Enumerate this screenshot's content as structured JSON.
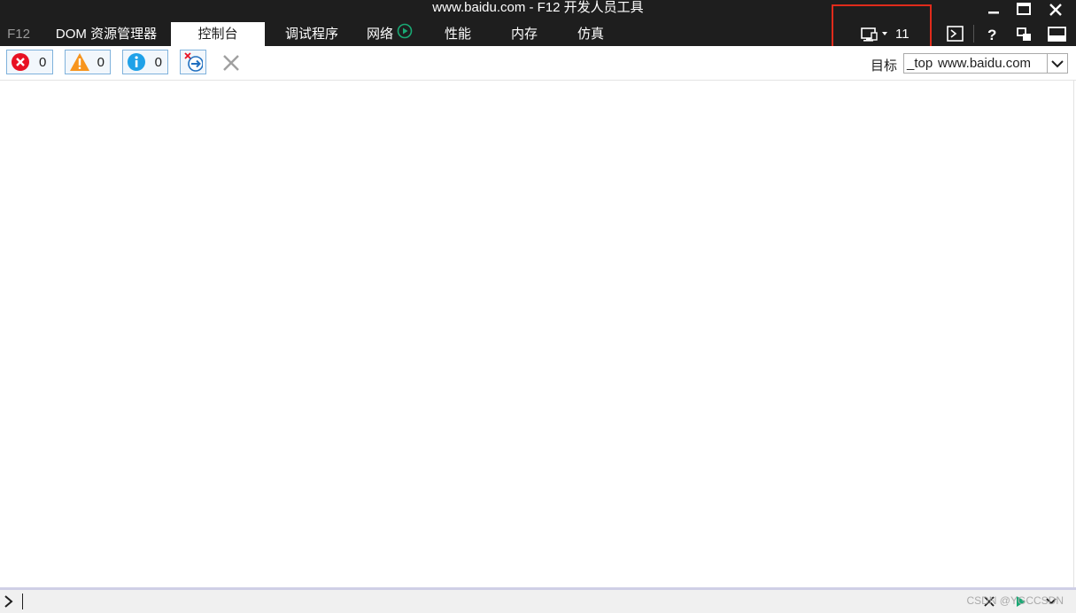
{
  "window": {
    "title": "www.baidu.com - F12 开发人员工具"
  },
  "tabs": [
    {
      "label": "F12"
    },
    {
      "label": "DOM 资源管理器"
    },
    {
      "label": "控制台"
    },
    {
      "label": "调试程序"
    },
    {
      "label": "网络"
    },
    {
      "label": "性能"
    },
    {
      "label": "内存"
    },
    {
      "label": "仿真"
    }
  ],
  "active_tab": "控制台",
  "document_mode": {
    "value": "11"
  },
  "filters": {
    "errors": {
      "count": "0"
    },
    "warnings": {
      "count": "0"
    },
    "messages": {
      "count": "0"
    }
  },
  "target": {
    "label": "目标",
    "frame": "_top",
    "url": "www.baidu.com"
  },
  "footer": {
    "watermark": "CSDN @YGCCSDN"
  },
  "colors": {
    "titlebar": "#1e1e1e",
    "highlight": "#e02b1b",
    "error": "#e81123",
    "warning": "#f7941d",
    "info": "#1fa1e8",
    "play": "#19a974"
  }
}
